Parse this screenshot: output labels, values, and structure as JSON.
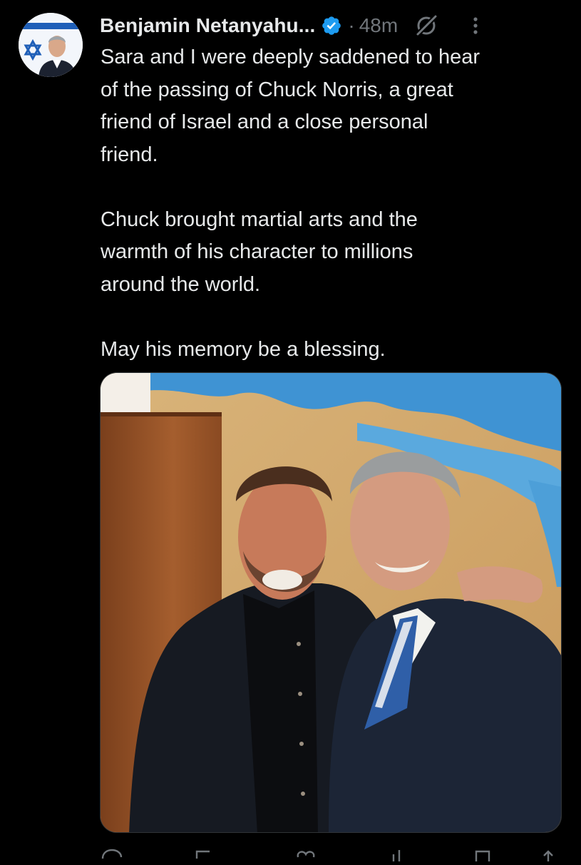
{
  "tweet": {
    "author": {
      "display_name": "Benjamin Netanyahu...",
      "verified": true,
      "avatar": "avatar-photo"
    },
    "separator": "·",
    "time": "48m",
    "text_paragraphs": [
      "Sara and I were deeply saddened to hear\nof the passing of Chuck Norris, a great\nfriend of Israel and a close personal\nfriend.",
      "Chuck brought martial arts and the\nwarmth of his character to millions\naround the world.",
      "May his memory be a blessing."
    ],
    "media": {
      "kind": "photo"
    },
    "icons": {
      "verified": "verified-badge-icon",
      "grok": "grok-icon",
      "more": "more-options-icon",
      "reply": "reply-icon",
      "repost": "repost-icon",
      "like": "like-icon",
      "views": "views-icon",
      "share": "share-icon"
    }
  },
  "colors": {
    "background": "#000000",
    "text_primary": "#e7e9ea",
    "text_secondary": "#71767b",
    "verified_badge": "#1d9bf0"
  }
}
